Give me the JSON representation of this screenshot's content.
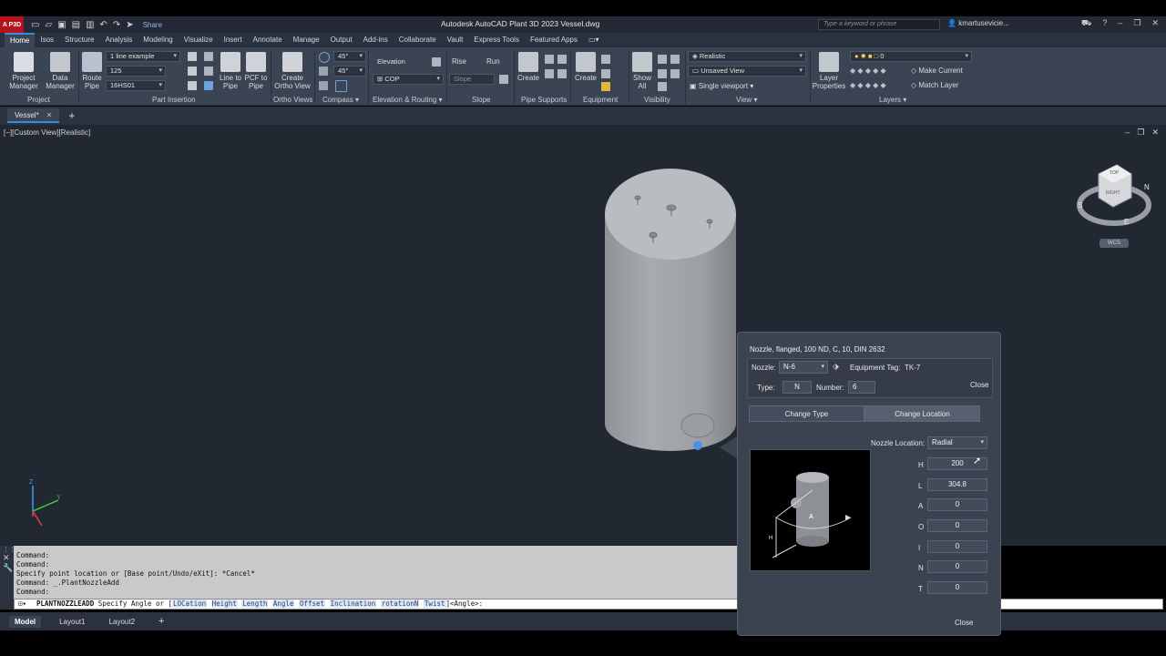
{
  "app": {
    "badge": "A P3D",
    "title": "Autodesk AutoCAD Plant 3D 2023    Vessel.dwg",
    "share_label": "Share",
    "search_placeholder": "Type a keyword or phrase",
    "user": "kmartusevicie..."
  },
  "ribbon_tabs": [
    "Home",
    "Isos",
    "Structure",
    "Analysis",
    "Modeling",
    "Visualize",
    "Insert",
    "Annotate",
    "Manage",
    "Output",
    "Add-ins",
    "Collaborate",
    "Vault",
    "Express Tools",
    "Featured Apps"
  ],
  "ribbon": {
    "project_manager": "Project\nManager",
    "data_manager": "Data\nManager",
    "route_pipe": "Route\nPipe",
    "line_to_pipe": "Line to\nPipe",
    "pcf_to_pipe": "PCF to\nPipe",
    "create_ortho": "Create\nOrtho View",
    "line_combo": "1 line example",
    "size_combo": "125",
    "spec_combo": "16HS01",
    "angle1": "45°",
    "angle2": "45°",
    "elevation": "Elevation",
    "cop": "COP",
    "rise": "Rise",
    "run": "Run",
    "slope": "Slope",
    "create1": "Create",
    "create2": "Create",
    "show_all": "Show\nAll",
    "visual_style": "Realistic",
    "view_combo": "Unsaved View",
    "single_viewport": "Single viewport",
    "layer_properties": "Layer\nProperties",
    "layer_combo": "0",
    "make_current": "Make Current",
    "match_layer": "Match Layer",
    "panels": {
      "project": "Project",
      "part_insertion": "Part Insertion",
      "ortho_views": "Ortho Views",
      "compass": "Compass",
      "elevation_routing": "Elevation & Routing",
      "slope": "Slope",
      "pipe_supports": "Pipe Supports",
      "equipment": "Equipment",
      "visibility": "Visibility",
      "view": "View",
      "layers": "Layers"
    }
  },
  "doc_tab": "Vessel*",
  "viewport": {
    "label": "[−][Custom View][Realistic]",
    "viewcube_top": "TOP",
    "viewcube_right": "RIGHT",
    "compass_n": "N",
    "compass_s": "S",
    "compass_e": "E",
    "wcs": "WCS"
  },
  "command_history": [
    "Command:",
    "Command:",
    "Specify point location or [Base point/Undo/eXit]: *Cancel*",
    "Command: _.PlantNozzleAdd",
    "Command:"
  ],
  "command_line": {
    "cmd": "PLANTNOZZLEADD",
    "prompt": "Specify Angle or [",
    "options": [
      "LOCation",
      "Height",
      "Length",
      "Angle",
      "Offset",
      "Inclination",
      "rotationN",
      "Twist"
    ],
    "suffix": "]<Angle>:"
  },
  "layout_tabs": [
    "Model",
    "Layout1",
    "Layout2"
  ],
  "dialog": {
    "title": "Nozzle, flanged, 100 ND, C, 10, DIN 2632",
    "nozzle_label": "Nozzle:",
    "nozzle_value": "N-6",
    "equipment_tag_label": "Equipment Tag:",
    "equipment_tag_value": "TK-7",
    "type_label": "Type:",
    "type_value": "N",
    "number_label": "Number:",
    "number_value": "6",
    "close_top": "Close",
    "change_type": "Change Type",
    "change_location": "Change Location",
    "nozzle_location_label": "Nozzle Location:",
    "nozzle_location_value": "Radial",
    "params": [
      {
        "label": "H",
        "value": "200"
      },
      {
        "label": "L",
        "value": "304.8"
      },
      {
        "label": "A",
        "value": "0"
      },
      {
        "label": "O",
        "value": "0"
      },
      {
        "label": "I",
        "value": "0"
      },
      {
        "label": "N",
        "value": "0"
      },
      {
        "label": "T",
        "value": "0"
      }
    ],
    "preview_letter_a": "A",
    "preview_letter_h": "H",
    "close_bottom": "Close"
  },
  "colors": {
    "viewport_bg": "#212831",
    "ribbon_bg": "#3b4453",
    "accent": "#2f8fe5",
    "nozzle_highlight": "#4d8fe8"
  }
}
